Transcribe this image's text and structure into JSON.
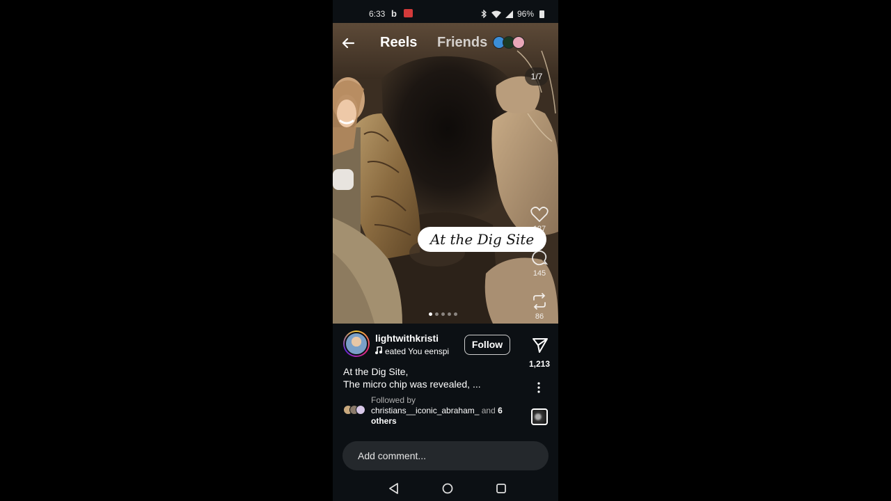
{
  "status_bar": {
    "time": "6:33",
    "bing_glyph": "b",
    "battery": "96%",
    "icons": [
      "bing-icon",
      "youtube-icon",
      "bluetooth-icon",
      "wifi-icon",
      "signal-icon",
      "battery-icon"
    ]
  },
  "top_nav": {
    "tabs": [
      {
        "label": "Reels",
        "active": true
      },
      {
        "label": "Friends",
        "active": false
      }
    ],
    "carousel_counter": "1/7"
  },
  "media": {
    "sticker_text": "At the Dig Site",
    "carousel_dots": [
      true,
      false,
      false,
      false,
      false
    ],
    "side_actions": [
      {
        "icon": "heart-icon",
        "count": "127"
      },
      {
        "icon": "comment-icon",
        "count": "145"
      },
      {
        "icon": "repost-icon",
        "count": "86"
      }
    ]
  },
  "post": {
    "username": "lightwithkristi",
    "audio": "eated You    eenspi",
    "follow_label": "Follow",
    "share_count": "1,213",
    "caption_line1": "At the Dig Site,",
    "caption_line2": "The micro chip was revealed, ...",
    "followed_by_label": "Followed by",
    "followed_by_names": "christians__iconic_abraham_",
    "followed_by_and": " and ",
    "followed_by_others": "6 others"
  },
  "comment": {
    "placeholder": "Add comment..."
  },
  "colors": {
    "background": "#0c1014",
    "comment_box": "#24282c",
    "story_ring_start": "#f9ce34",
    "story_ring_mid": "#ee2a7b",
    "story_ring_end": "#6228d7"
  }
}
